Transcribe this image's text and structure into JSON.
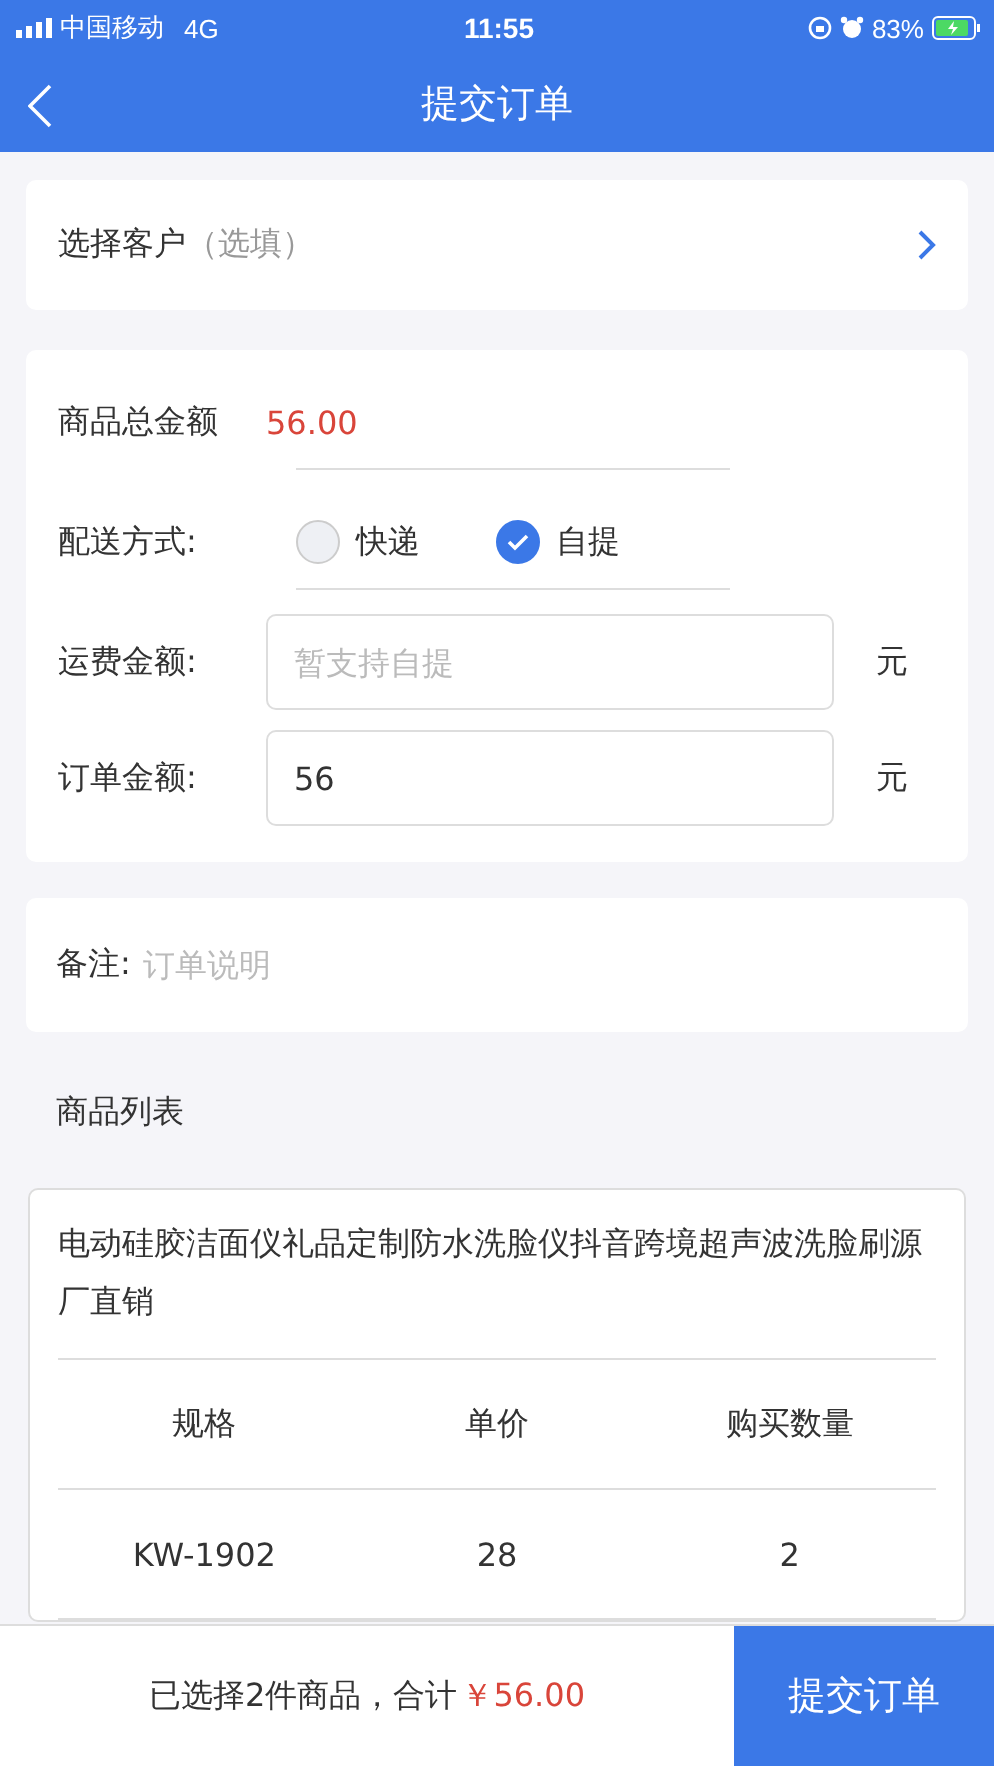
{
  "status_bar": {
    "carrier": "中国移动",
    "network": "4G",
    "time": "11:55",
    "battery": "83%"
  },
  "nav": {
    "title": "提交订单"
  },
  "customer": {
    "label": "选择客户",
    "hint": "（选填）"
  },
  "summary": {
    "total_label": "商品总金额",
    "total_value": "56.00",
    "delivery_label": "配送方式:",
    "delivery_options": [
      {
        "label": "快递",
        "selected": false
      },
      {
        "label": "自提",
        "selected": true
      }
    ],
    "shipping_label": "运费金额:",
    "shipping_placeholder": "暂支持自提",
    "shipping_unit": "元",
    "order_label": "订单金额:",
    "order_value": "56",
    "order_unit": "元"
  },
  "remark": {
    "label": "备注:",
    "placeholder": "订单说明"
  },
  "product_list": {
    "title": "商品列表",
    "name": "电动硅胶洁面仪礼品定制防水洗脸仪抖音跨境超声波洗脸刷源厂直销",
    "columns": [
      "规格",
      "单价",
      "购买数量"
    ],
    "rows": [
      [
        "KW-1902",
        "28",
        "2"
      ]
    ]
  },
  "bottom_bar": {
    "summary": "已选择2件商品，合计",
    "total": "￥56.00",
    "submit": "提交订单"
  }
}
